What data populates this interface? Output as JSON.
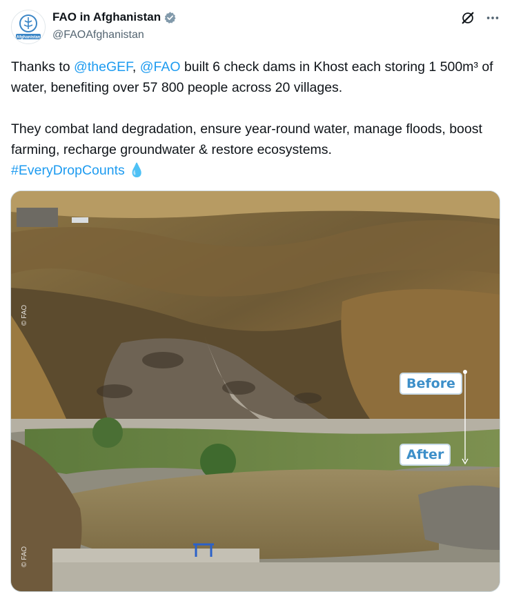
{
  "account": {
    "display_name": "FAO in Afghanistan",
    "handle": "@FAOAfghanistan",
    "avatar_label": "Afghanistan"
  },
  "tweet": {
    "p1_pre": "Thanks to ",
    "mention1": "@theGEF",
    "p1_sep": ", ",
    "mention2": "@FAO",
    "p1_post": " built 6 check dams in Khost each storing 1 500m³ of water, benefiting over 57 800 people across 20 villages.",
    "p2": "They combat land degradation, ensure year-round water, manage floods, boost farming, recharge groundwater & restore ecosystems.",
    "hashtag": "#EveryDropCounts",
    "emoji": "💧"
  },
  "media": {
    "before_label": "Before",
    "after_label": "After",
    "copyright_top": "© FAO",
    "copyright_bottom": "© FAO"
  },
  "icons": {
    "verified": "verified-badge-icon",
    "grok": "grok-icon",
    "more": "more-icon"
  },
  "colors": {
    "accent": "#1d9bf0",
    "badge_text": "#3d8fc9"
  }
}
